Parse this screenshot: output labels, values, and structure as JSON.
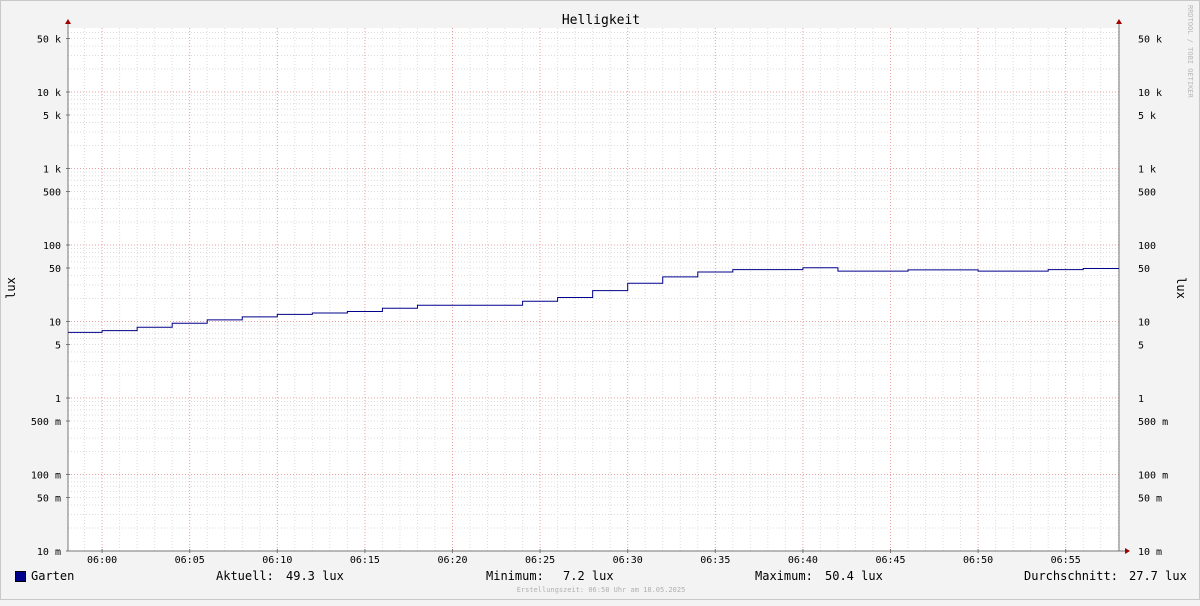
{
  "chart_data": {
    "type": "line",
    "title": "Helligkeit",
    "ylabel": "lux",
    "y_scale": "log",
    "ylim": [
      "10 m",
      "80 k"
    ],
    "watermark": "RRDTOOL / TOBI OETIKER",
    "x_tick_labels": [
      "06:00",
      "06:05",
      "06:10",
      "06:15",
      "06:20",
      "06:25",
      "06:30",
      "06:35",
      "06:40",
      "06:45",
      "06:50",
      "06:55"
    ],
    "y_tick_labels": [
      {
        "value": 0.01,
        "label": "10 m"
      },
      {
        "value": 0.05,
        "label": "50 m"
      },
      {
        "value": 0.1,
        "label": "100 m"
      },
      {
        "value": 0.5,
        "label": "500 m"
      },
      {
        "value": 1,
        "label": "1"
      },
      {
        "value": 5,
        "label": "5"
      },
      {
        "value": 10,
        "label": "10"
      },
      {
        "value": 50,
        "label": "50"
      },
      {
        "value": 100,
        "label": "100"
      },
      {
        "value": 500,
        "label": "500"
      },
      {
        "value": 1000,
        "label": "1 k"
      },
      {
        "value": 5000,
        "label": "5 k"
      },
      {
        "value": 10000,
        "label": "10 k"
      },
      {
        "value": 50000,
        "label": "50 k"
      }
    ],
    "series": [
      {
        "name": "Garten",
        "color": "#00008b",
        "points": [
          {
            "x": "05:58",
            "y": 7.2
          },
          {
            "x": "06:00",
            "y": 7.6
          },
          {
            "x": "06:02",
            "y": 8.4
          },
          {
            "x": "06:04",
            "y": 9.5
          },
          {
            "x": "06:06",
            "y": 10.5
          },
          {
            "x": "06:08",
            "y": 11.5
          },
          {
            "x": "06:10",
            "y": 12.4
          },
          {
            "x": "06:12",
            "y": 12.9
          },
          {
            "x": "06:14",
            "y": 13.5
          },
          {
            "x": "06:16",
            "y": 14.9
          },
          {
            "x": "06:18",
            "y": 16.3
          },
          {
            "x": "06:24",
            "y": 18.4
          },
          {
            "x": "06:26",
            "y": 20.6
          },
          {
            "x": "06:28",
            "y": 25.3
          },
          {
            "x": "06:30",
            "y": 31.6
          },
          {
            "x": "06:32",
            "y": 38.3
          },
          {
            "x": "06:34",
            "y": 44.3
          },
          {
            "x": "06:36",
            "y": 47.7
          },
          {
            "x": "06:40",
            "y": 50.4
          },
          {
            "x": "06:42",
            "y": 45.5
          },
          {
            "x": "06:46",
            "y": 47.3
          },
          {
            "x": "06:50",
            "y": 45.5
          },
          {
            "x": "06:54",
            "y": 47.7
          },
          {
            "x": "06:56",
            "y": 49.3
          },
          {
            "x": "06:58",
            "y": 49.3
          }
        ]
      }
    ]
  },
  "legend": {
    "series_name": "Garten",
    "current_label": "Aktuell:",
    "current_value": "49.3 lux",
    "min_label": "Minimum:",
    "min_value": "7.2 lux",
    "max_label": "Maximum:",
    "max_value": "50.4 lux",
    "avg_label": "Durchschnitt:",
    "avg_value": "27.7 lux"
  },
  "footer": "Erstellungszeit: 06:58 Uhr am 18.05.2025"
}
